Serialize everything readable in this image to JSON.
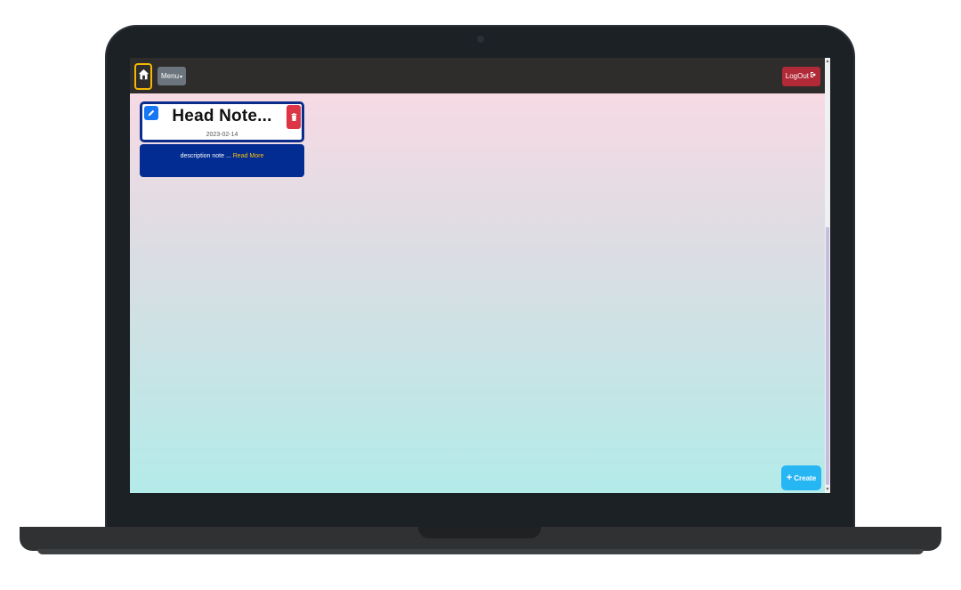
{
  "navbar": {
    "menu_label": "Menu",
    "logout_label": "LogOut"
  },
  "note": {
    "title": "Head Note...",
    "date": "2023-02-14",
    "description": "description note ... ",
    "read_more": "Read More"
  },
  "create": {
    "plus": "+",
    "label": "Create"
  },
  "colors": {
    "navbar": "#2f2c2c",
    "home_border": "#f5b800",
    "logout": "#b02a37",
    "edit": "#1877f2",
    "delete": "#dc3545",
    "note_body": "#022c91",
    "create": "#27b6f4"
  },
  "icons": {
    "home": "home-icon",
    "menu_caret": "caret-down-icon",
    "logout": "logout-icon",
    "edit": "pencil-icon",
    "delete": "trash-icon"
  }
}
